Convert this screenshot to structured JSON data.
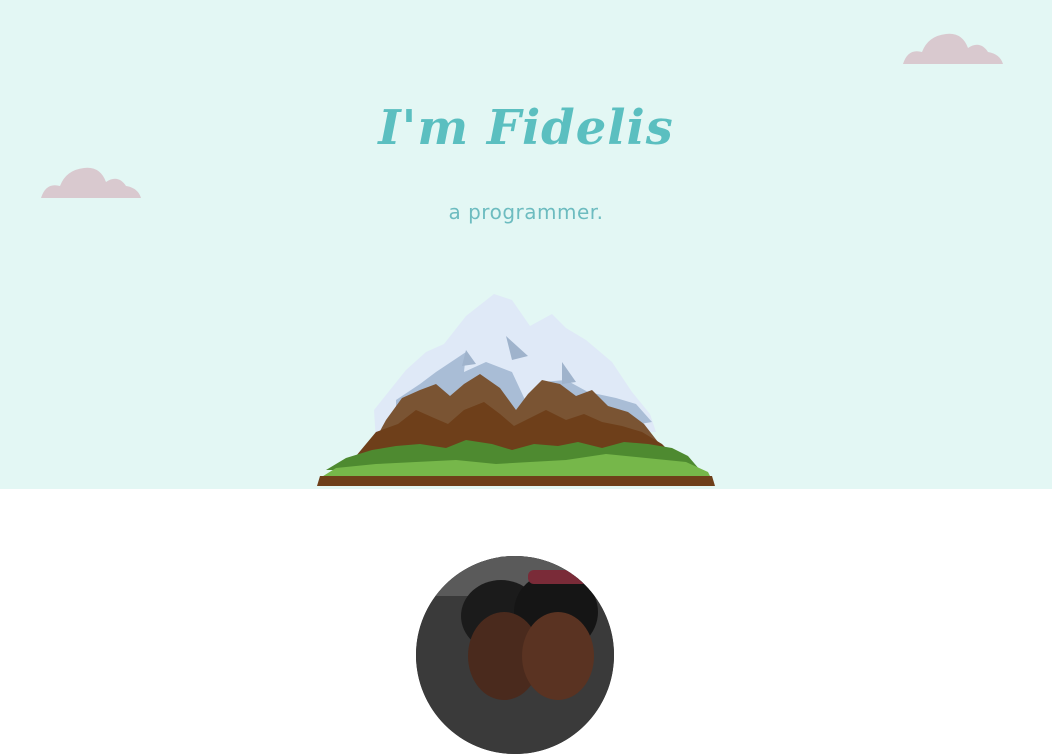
{
  "hero": {
    "headline": "I'm Fidelis",
    "subtitle": "a programmer.",
    "colors": {
      "background": "#e3f7f4",
      "headline": "#5bbfc0",
      "cloud": "#d9c9cf"
    }
  },
  "decor": {
    "clouds": [
      "cloud-icon",
      "cloud-icon"
    ],
    "illustration": "mountain-illustration"
  },
  "about": {
    "avatar": "profile-photo"
  }
}
